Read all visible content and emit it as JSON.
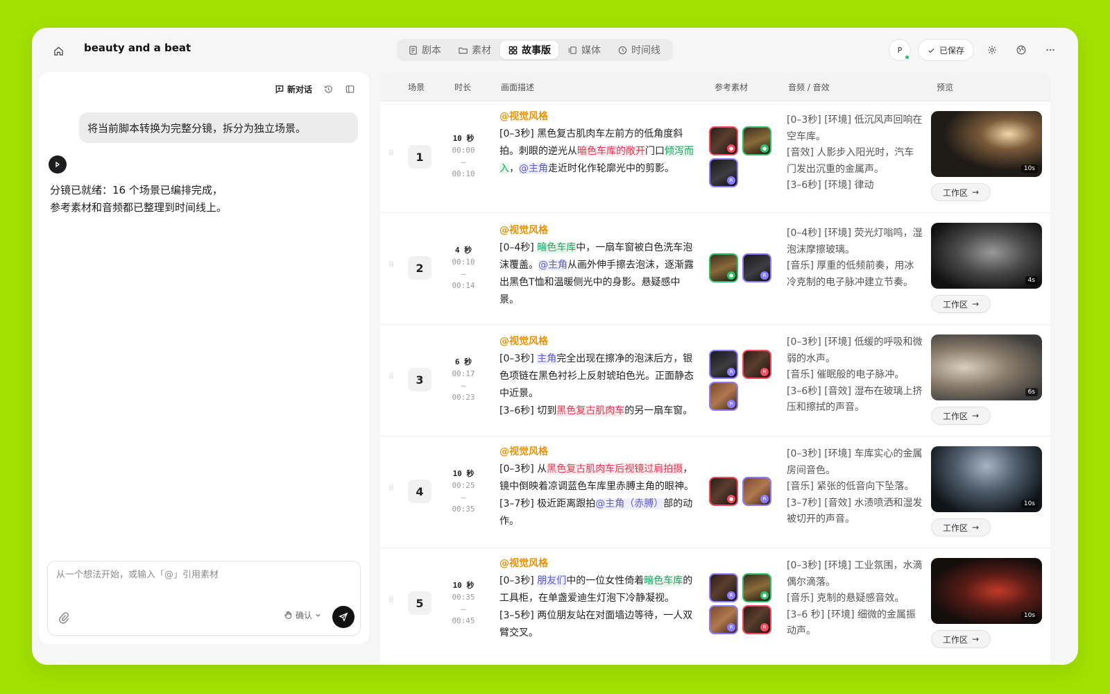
{
  "app": {
    "title": "beauty and a beat"
  },
  "tabs": [
    {
      "label": "剧本",
      "icon": "script-icon"
    },
    {
      "label": "素材",
      "icon": "folder-icon"
    },
    {
      "label": "故事版",
      "icon": "grid-icon",
      "active": true
    },
    {
      "label": "媒体",
      "icon": "media-icon"
    },
    {
      "label": "时间线",
      "icon": "clock-icon"
    }
  ],
  "topbar": {
    "avatar": "P",
    "saved_label": "已保存"
  },
  "chat": {
    "new_chat_label": "新对话",
    "user_message": "将当前脚本转换为完整分镜，拆分为独立场景。",
    "bot_message": "分镜已就绪：16 个场景已编排完成，\n参考素材和音频都已整理到时间线上。",
    "input_placeholder": "从一个想法开始，或输入「@」引用素材",
    "confirm_label": "确认"
  },
  "columns": {
    "scene": "场景",
    "duration": "时长",
    "description": "画面描述",
    "refs": "参考素材",
    "audio": "音频 / 音效",
    "preview": "预览"
  },
  "scenes": [
    {
      "index": "1",
      "duration": "10 秒",
      "start": "00:00",
      "sep": "–",
      "end": "00:10",
      "style": "@视觉风格",
      "audio": "[0–3秒] [环境] 低沉风声回响在空车库。\n[音效] 人影步入阳光时，汽车门发出沉重的金属声。\n[3–6秒] [环境] 律动",
      "preview_badge": "10s",
      "workspace_label": "工作区"
    },
    {
      "index": "2",
      "duration": "4 秒",
      "start": "00:10",
      "sep": "–",
      "end": "00:14",
      "style": "@视觉风格",
      "audio": "[0–4秒] [环境] 荧光灯嗡鸣，湿泡沫摩擦玻璃。\n[音乐] 厚重的低频前奏，用冰冷克制的电子脉冲建立节奏。",
      "preview_badge": "4s",
      "workspace_label": "工作区"
    },
    {
      "index": "3",
      "duration": "6 秒",
      "start": "00:17",
      "sep": "–",
      "end": "00:23",
      "style": "@视觉风格",
      "audio": "[0–3秒] [环境] 低缓的呼吸和微弱的水声。\n[音乐] 催眠般的电子脉冲。\n[3–6秒] [音效] 湿布在玻璃上挤压和擦拭的声音。",
      "preview_badge": "6s",
      "workspace_label": "工作区"
    },
    {
      "index": "4",
      "duration": "10 秒",
      "start": "00:25",
      "sep": "–",
      "end": "00:35",
      "style": "@视觉风格",
      "audio": "[0–3秒] [环境] 车库实心的金属房间音色。\n[音乐] 紧张的低音向下坠落。\n[3–7秒] [音效] 水渍喷洒和湿发被切开的声音。",
      "preview_badge": "10s",
      "workspace_label": "工作区"
    },
    {
      "index": "5",
      "duration": "10 秒",
      "start": "00:35",
      "sep": "–",
      "end": "00:45",
      "style": "@视觉风格",
      "audio": "[0–3秒] [环境] 工业氛围，水滴偶尔滴落。\n[音乐] 克制的悬疑感音效。\n[3–6 秒] [环境] 细微的金属振动声。",
      "preview_badge": "10s",
      "workspace_label": "工作区"
    }
  ],
  "desc": {
    "s1": {
      "a": "[0–3秒] 黑色复古肌肉车左前方的低角度斜拍。刺眼的逆光从",
      "b": "暗色车库的敞开",
      "c": "门口",
      "d": "倾泻而入",
      "e": "，",
      "f": "@主角",
      "g": "走近时化作轮廓光中的剪影。"
    },
    "s2": {
      "a": "[0–4秒] ",
      "b": "暗色车库",
      "c": "中，一扇车窗被白色洗车泡沫覆盖。",
      "d": "@主角",
      "e": "从画外伸手擦去泡沫，逐渐露出黑色T恤和温暖侧光中的身影。悬疑感中景。"
    },
    "s3": {
      "a": "[0–3秒] ",
      "b": "主角",
      "c": "完全出现在擦净的泡沫后方，银色项链在黑色衬衫上反射琥珀色光。正面静态中近景。",
      "d": "[3–6秒] 切到",
      "e": "黑色复古肌肉车",
      "f": "的另一扇车窗。"
    },
    "s4": {
      "a": "[0–3秒] 从",
      "b": "黑色复古肌肉车后视镜过肩拍摄",
      "c": "，镜中倒映着凉调蓝色车库里赤膊主角的眼神。",
      "d": "[3–7秒] 极近距离跟拍",
      "e": "@主角（赤膊）",
      "f": "部的动作。"
    },
    "s5": {
      "a": "[0–3秒] ",
      "b": "朋友们",
      "c": "中的一位女性倚着",
      "d": "暗色车库",
      "e": "的工具柜，在单盏爱迪生灯泡下冷静凝视。",
      "f": "[3–5秒] 两位朋友站在对面墙边等待，一人双臂交叉。"
    }
  },
  "colors": {
    "accent_style": "#e8940a",
    "ref_red": "#f24a5f",
    "ref_green": "#2fc06b",
    "ref_purple": "#8b7bff"
  }
}
